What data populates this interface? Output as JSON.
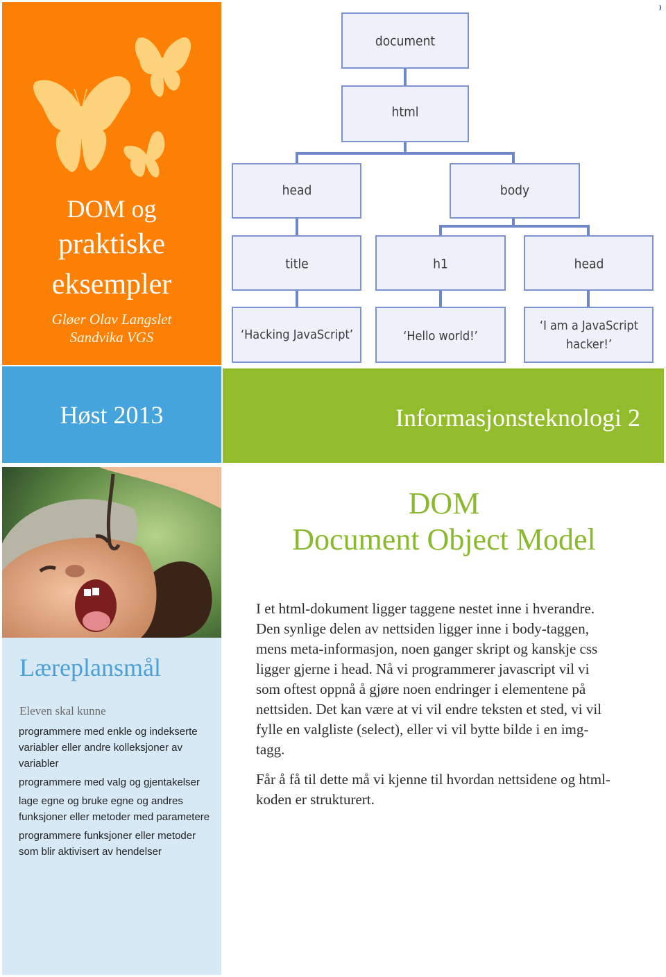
{
  "cover": {
    "title_line1": "DOM og",
    "title_line2": "praktiske",
    "title_line3": "eksempler",
    "author": "Gløer Olav Langslet",
    "school": "Sandvika VGS",
    "accent_orange": "#fd8006",
    "butterfly_color": "#fdd27c"
  },
  "diagram": {
    "nodes": {
      "document": "document",
      "html": "html",
      "head": "head",
      "body": "body",
      "title": "title",
      "h1": "h1",
      "head2": "head",
      "text_title": "‘Hacking JavaScript’",
      "text_h1": "‘Hello world!’",
      "text_head2_line1": "‘I am a JavaScript",
      "text_head2_line2": "hacker!’"
    },
    "corner_mark": "⁾"
  },
  "bands": {
    "semester": "Høst 2013",
    "course": "Informasjonsteknologi 2",
    "blue": "#45a4dc",
    "green": "#93bc2c"
  },
  "sidebar": {
    "title": "Læreplansmål",
    "intro": "Eleven skal kunne",
    "goals": [
      "programmere med enkle og indekserte variabler eller andre kolleksjoner av variabler",
      "programmere med valg og gjentakelser",
      "lage egne og bruke egne og andres funksjoner eller metoder med parametere",
      "programmere funksjoner eller metoder som blir aktivisert av hendelser"
    ]
  },
  "main": {
    "heading_line1": "DOM",
    "heading_line2": "Document Object Model",
    "paragraphs": [
      "I et html-dokument ligger taggene nestet inne i hverandre. Den synlige delen av nettsiden ligger inne i body-taggen, mens meta-informasjon, noen ganger skript og kanskje css ligger gjerne i head. Nå vi programmerer javascript vil vi som oftest oppnå å gjøre noen endringer i elementene på nettsiden. Det kan være at vi vil endre teksten et sted, vi vil fylle en valgliste (select), eller vi vil bytte bilde i en img-tagg.",
      "Får å få til dette må vi kjenne til hvordan nettsidene og html-koden er strukturert."
    ]
  }
}
